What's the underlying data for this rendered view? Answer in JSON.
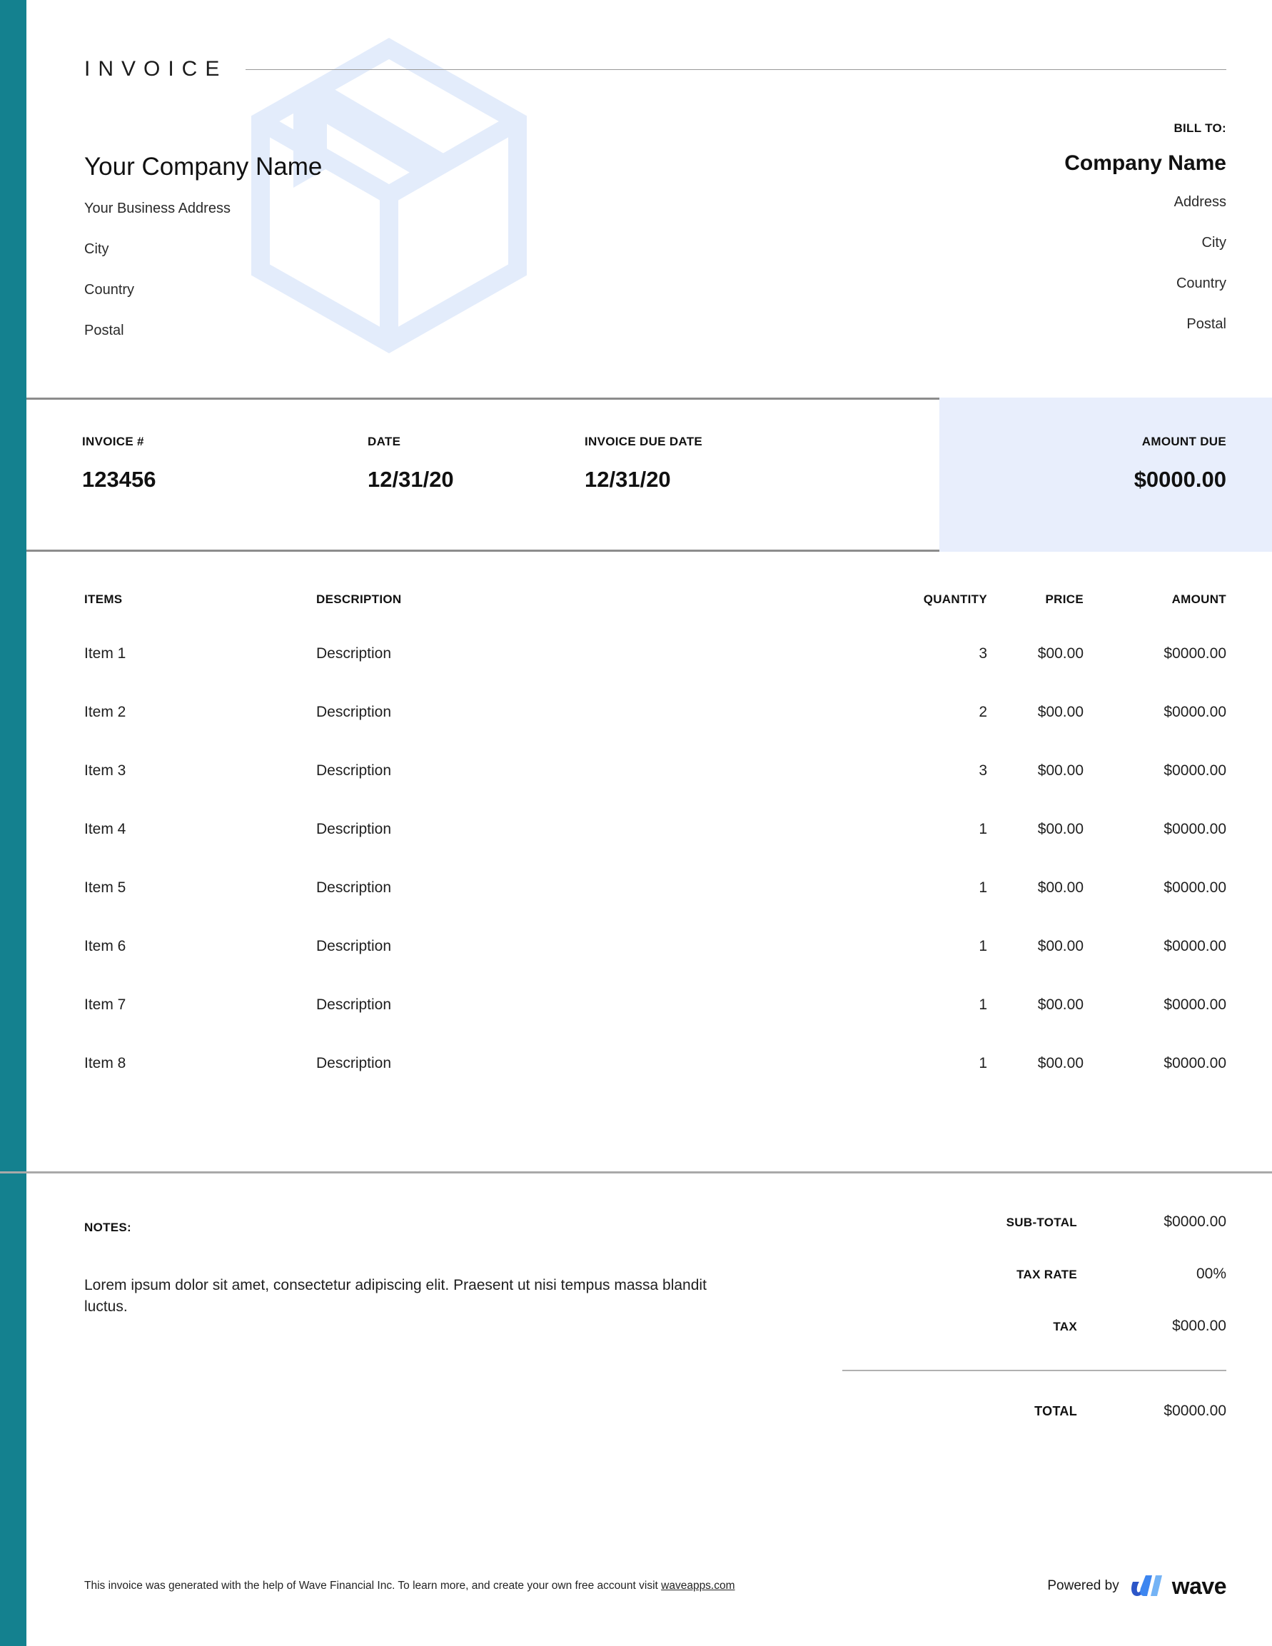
{
  "document": {
    "title": "INVOICE"
  },
  "colors": {
    "side_bar": "#14818f",
    "amount_due_panel": "#e8eefc",
    "watermark": "#e3ecfb",
    "rule": "#8c8c8c",
    "wave_dark": "#2c56c8",
    "wave_mid": "#3d86f0",
    "wave_light": "#74b3f5"
  },
  "sender": {
    "company_name": "Your Company Name",
    "address": "Your Business Address",
    "city": "City",
    "country": "Country",
    "postal": "Postal"
  },
  "bill_to": {
    "label": "BILL TO:",
    "company_name": "Company Name",
    "address": "Address",
    "city": "City",
    "country": "Country",
    "postal": "Postal"
  },
  "meta": {
    "invoice_number_label": "INVOICE #",
    "invoice_number": "123456",
    "date_label": "DATE",
    "date": "12/31/20",
    "due_date_label": "INVOICE DUE DATE",
    "due_date": "12/31/20",
    "amount_due_label": "AMOUNT DUE",
    "amount_due": "$0000.00"
  },
  "items_table": {
    "headers": {
      "item": "ITEMS",
      "description": "DESCRIPTION",
      "quantity": "QUANTITY",
      "price": "PRICE",
      "amount": "AMOUNT"
    },
    "rows": [
      {
        "item": "Item 1",
        "description": "Description",
        "quantity": "3",
        "price": "$00.00",
        "amount": "$0000.00"
      },
      {
        "item": "Item 2",
        "description": "Description",
        "quantity": "2",
        "price": "$00.00",
        "amount": "$0000.00"
      },
      {
        "item": "Item 3",
        "description": "Description",
        "quantity": "3",
        "price": "$00.00",
        "amount": "$0000.00"
      },
      {
        "item": "Item 4",
        "description": "Description",
        "quantity": "1",
        "price": "$00.00",
        "amount": "$0000.00"
      },
      {
        "item": "Item 5",
        "description": "Description",
        "quantity": "1",
        "price": "$00.00",
        "amount": "$0000.00"
      },
      {
        "item": "Item 6",
        "description": "Description",
        "quantity": "1",
        "price": "$00.00",
        "amount": "$0000.00"
      },
      {
        "item": "Item 7",
        "description": "Description",
        "quantity": "1",
        "price": "$00.00",
        "amount": "$0000.00"
      },
      {
        "item": "Item 8",
        "description": "Description",
        "quantity": "1",
        "price": "$00.00",
        "amount": "$0000.00"
      }
    ]
  },
  "notes": {
    "label": "NOTES:",
    "text": "Lorem ipsum dolor sit amet, consectetur adipiscing elit. Praesent ut nisi tempus massa blandit luctus."
  },
  "totals": {
    "subtotal_label": "SUB-TOTAL",
    "subtotal_value": "$0000.00",
    "tax_rate_label": "TAX RATE",
    "tax_rate_value": "00%",
    "tax_label": "TAX",
    "tax_value": "$000.00",
    "total_label": "TOTAL",
    "total_value": "$0000.00"
  },
  "footer": {
    "text_before_link": "This invoice was generated with the help of Wave Financial Inc. To learn more, and create your own free account visit ",
    "link_text": "waveapps.com",
    "powered_by_label": "Powered by",
    "wave_wordmark": "wave"
  }
}
